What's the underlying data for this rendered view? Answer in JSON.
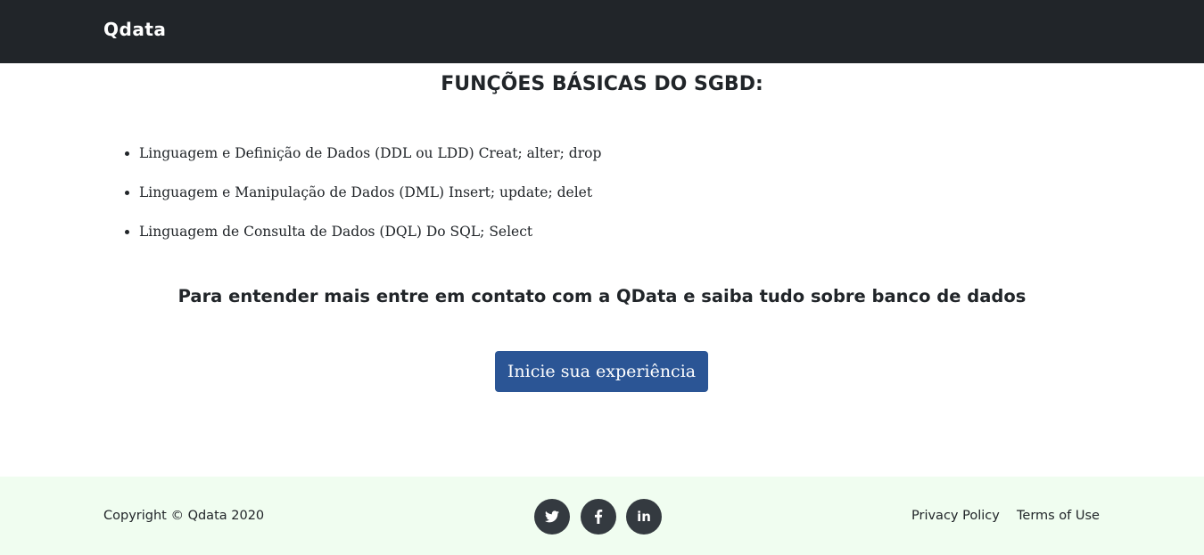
{
  "navbar": {
    "brand": "Qdata",
    "background": "#212529"
  },
  "main": {
    "heading": "FUNÇÕES BÁSICAS DO SGBD:",
    "items": [
      "Linguagem e Definição de Dados (DDL ou LDD) Creat; alter; drop",
      "Linguagem e Manipulação de Dados (DML) Insert; update; delet",
      "Linguagem de Consulta de Dados (DQL) Do SQL; Select"
    ],
    "cta_text": "Para entender mais entre em contato com a QData e saiba tudo sobre banco de dados",
    "cta_button": "Inicie sua experiência",
    "button_color": "#2b5595"
  },
  "footer": {
    "copyright": "Copyright © Qdata 2020",
    "social": [
      {
        "icon": "twitter-icon"
      },
      {
        "icon": "facebook-icon"
      },
      {
        "icon": "linkedin-icon",
        "glyph": "in"
      }
    ],
    "privacy_link": "Privacy Policy",
    "terms_link": "Terms of Use",
    "background": "#f0fdf0"
  }
}
